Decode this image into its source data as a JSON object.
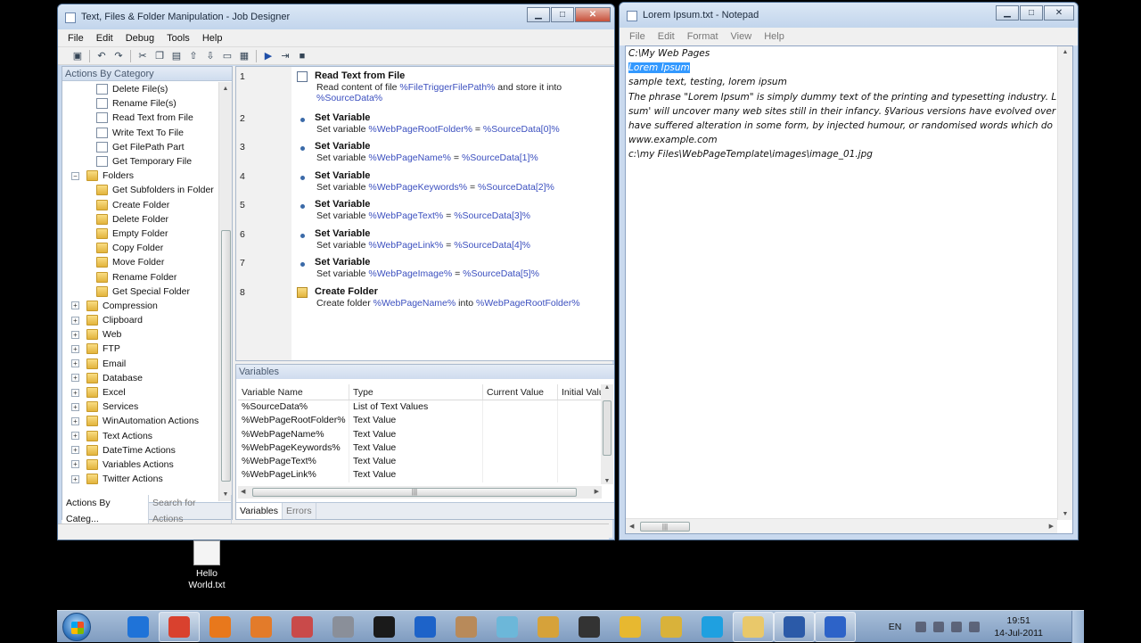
{
  "job_designer": {
    "title": "Text, Files & Folder Manipulation - Job Designer",
    "menu": [
      "File",
      "Edit",
      "Debug",
      "Tools",
      "Help"
    ],
    "actions_panel_title": "Actions By Category",
    "tree": [
      {
        "label": "Delete File(s)",
        "type": "doc",
        "level": 2
      },
      {
        "label": "Rename File(s)",
        "type": "doc",
        "level": 2
      },
      {
        "label": "Read Text from File",
        "type": "doc",
        "level": 2
      },
      {
        "label": "Write Text To File",
        "type": "doc",
        "level": 2
      },
      {
        "label": "Get FilePath Part",
        "type": "doc",
        "level": 2
      },
      {
        "label": "Get Temporary File",
        "type": "doc",
        "level": 2
      },
      {
        "label": "Folders",
        "type": "folder",
        "level": 1,
        "expander": "−"
      },
      {
        "label": "Get Subfolders in Folder",
        "type": "folder",
        "level": 2
      },
      {
        "label": "Create Folder",
        "type": "folder",
        "level": 2
      },
      {
        "label": "Delete Folder",
        "type": "folder",
        "level": 2
      },
      {
        "label": "Empty Folder",
        "type": "folder",
        "level": 2
      },
      {
        "label": "Copy Folder",
        "type": "folder",
        "level": 2
      },
      {
        "label": "Move Folder",
        "type": "folder",
        "level": 2
      },
      {
        "label": "Rename Folder",
        "type": "folder",
        "level": 2
      },
      {
        "label": "Get Special Folder",
        "type": "folder",
        "level": 2
      },
      {
        "label": "Compression",
        "type": "folder",
        "level": 1,
        "expander": "+"
      },
      {
        "label": "Clipboard",
        "type": "folder",
        "level": 1,
        "expander": "+"
      },
      {
        "label": "Web",
        "type": "folder",
        "level": 1,
        "expander": "+"
      },
      {
        "label": "FTP",
        "type": "folder",
        "level": 1,
        "expander": "+"
      },
      {
        "label": "Email",
        "type": "folder",
        "level": 1,
        "expander": "+"
      },
      {
        "label": "Database",
        "type": "folder",
        "level": 1,
        "expander": "+"
      },
      {
        "label": "Excel",
        "type": "folder",
        "level": 1,
        "expander": "+"
      },
      {
        "label": "Services",
        "type": "folder",
        "level": 1,
        "expander": "+"
      },
      {
        "label": "WinAutomation Actions",
        "type": "folder",
        "level": 1,
        "expander": "+"
      },
      {
        "label": "Text Actions",
        "type": "folder",
        "level": 1,
        "expander": "+"
      },
      {
        "label": "DateTime Actions",
        "type": "folder",
        "level": 1,
        "expander": "+"
      },
      {
        "label": "Variables Actions",
        "type": "folder",
        "level": 1,
        "expander": "+"
      },
      {
        "label": "Twitter Actions",
        "type": "folder",
        "level": 1,
        "expander": "+"
      }
    ],
    "left_tabs": [
      "Actions By Categ...",
      "Search for Actions"
    ],
    "steps": [
      {
        "num": "1",
        "title": "Read Text from File",
        "icon": "file",
        "desc_prefix": "Read content of file ",
        "var1": "%FileTriggerFilePath%",
        "desc_mid": " and store it into ",
        "var2": "%SourceData%"
      },
      {
        "num": "2",
        "title": "Set Variable",
        "icon": "bullet",
        "desc_prefix": "Set variable ",
        "var1": "%WebPageRootFolder%",
        "desc_mid": " = ",
        "var2": "%SourceData[0]%"
      },
      {
        "num": "3",
        "title": "Set Variable",
        "icon": "bullet",
        "desc_prefix": "Set variable ",
        "var1": "%WebPageName%",
        "desc_mid": " = ",
        "var2": "%SourceData[1]%"
      },
      {
        "num": "4",
        "title": "Set Variable",
        "icon": "bullet",
        "desc_prefix": "Set variable ",
        "var1": "%WebPageKeywords%",
        "desc_mid": " = ",
        "var2": "%SourceData[2]%"
      },
      {
        "num": "5",
        "title": "Set Variable",
        "icon": "bullet",
        "desc_prefix": "Set variable ",
        "var1": "%WebPageText%",
        "desc_mid": " = ",
        "var2": "%SourceData[3]%"
      },
      {
        "num": "6",
        "title": "Set Variable",
        "icon": "bullet",
        "desc_prefix": "Set variable ",
        "var1": "%WebPageLink%",
        "desc_mid": " = ",
        "var2": "%SourceData[4]%"
      },
      {
        "num": "7",
        "title": "Set Variable",
        "icon": "bullet",
        "desc_prefix": "Set variable ",
        "var1": "%WebPageImage%",
        "desc_mid": " = ",
        "var2": "%SourceData[5]%"
      },
      {
        "num": "8",
        "title": "Create Folder",
        "icon": "folder",
        "desc_prefix": "Create folder ",
        "var1": "%WebPageName%",
        "desc_mid": " into ",
        "var2": "%WebPageRootFolder%"
      }
    ],
    "variables_panel_title": "Variables",
    "variable_columns": [
      "Variable Name",
      "Type",
      "Current Value",
      "Initial Valu"
    ],
    "variables": [
      {
        "name": "%SourceData%",
        "type": "List of Text Values"
      },
      {
        "name": "%WebPageRootFolder%",
        "type": "Text Value"
      },
      {
        "name": "%WebPageName%",
        "type": "Text Value"
      },
      {
        "name": "%WebPageKeywords%",
        "type": "Text Value"
      },
      {
        "name": "%WebPageText%",
        "type": "Text Value"
      },
      {
        "name": "%WebPageLink%",
        "type": "Text Value"
      }
    ],
    "bottom_tabs": [
      "Variables",
      "Errors"
    ]
  },
  "notepad": {
    "title": "Lorem Ipsum.txt - Notepad",
    "menu": [
      "File",
      "Edit",
      "Format",
      "View",
      "Help"
    ],
    "lines": [
      "C:\\My Web Pages",
      "Lorem Ipsum",
      "sample text, testing, lorem ipsum",
      "The phrase \"Lorem Ipsum\" is simply dummy text of the printing and typesetting industry. L",
      "sum' will uncover many web sites still in their infancy. §Various versions have evolved over",
      "have suffered alteration in some form, by injected humour, or randomised words which do",
      "www.example.com",
      "c:\\my Files\\WebPageTemplate\\images\\image_01.jpg"
    ],
    "selected_line_index": 1
  },
  "desktop_icon": {
    "label_line1": "Hello",
    "label_line2": "World.txt"
  },
  "taskbar": {
    "apps": [
      {
        "name": "internet-explorer-icon",
        "color": "#1f73d8",
        "open": false
      },
      {
        "name": "chrome-icon",
        "color": "#d9412e",
        "open": true
      },
      {
        "name": "firefox-icon",
        "color": "#e8781c",
        "open": false
      },
      {
        "name": "media-player-icon",
        "color": "#e37b2a",
        "open": false
      },
      {
        "name": "snipping-tool-icon",
        "color": "#c94a4a",
        "open": false
      },
      {
        "name": "database-icon",
        "color": "#8a8f99",
        "open": false
      },
      {
        "name": "command-prompt-icon",
        "color": "#1a1a1a",
        "open": false
      },
      {
        "name": "teamviewer-icon",
        "color": "#1d63c9",
        "open": false
      },
      {
        "name": "coffee-cup-icon",
        "color": "#b88a5a",
        "open": false
      },
      {
        "name": "notes-icon",
        "color": "#6cb7d9",
        "open": false
      },
      {
        "name": "winautomation-icon",
        "color": "#d6a23a",
        "open": false
      },
      {
        "name": "qr-code-icon",
        "color": "#333333",
        "open": false
      },
      {
        "name": "puzzle-icon",
        "color": "#e7b830",
        "open": false
      },
      {
        "name": "builder-icon",
        "color": "#d9b23a",
        "open": false
      },
      {
        "name": "skype-icon",
        "color": "#1fa0e0",
        "open": false
      },
      {
        "name": "explorer-folder-icon",
        "color": "#e9c86a",
        "open": true
      },
      {
        "name": "word-icon",
        "color": "#2b5aa8",
        "open": true
      },
      {
        "name": "gear-flower-icon",
        "color": "#2d63c8",
        "open": true
      }
    ],
    "language": "EN",
    "time": "19:51",
    "date": "14-Jul-2011"
  }
}
